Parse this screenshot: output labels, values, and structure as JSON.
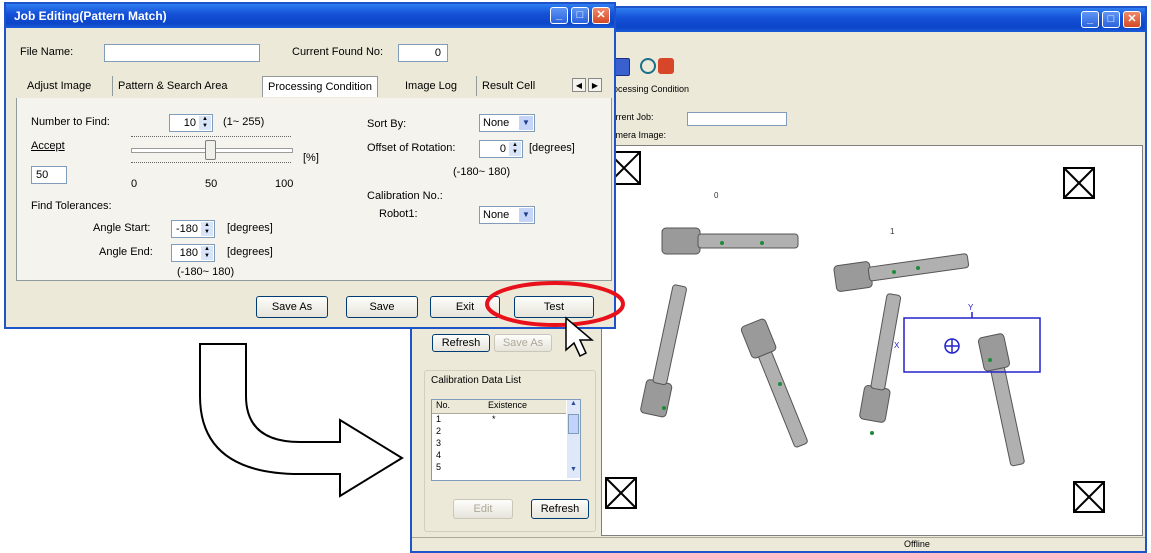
{
  "job_window": {
    "title": "Job Editing(Pattern Match)",
    "file_name_label": "File Name:",
    "file_name_value": "",
    "current_found_label": "Current Found No:",
    "current_found_value": "0",
    "tabs": [
      "Adjust Image",
      "Pattern & Search Area",
      "Processing Condition",
      "Image Log",
      "Result Cell"
    ],
    "active_tab": "Processing Condition",
    "number_to_find_label": "Number to Find:",
    "number_to_find_value": "10",
    "number_to_find_range": "(1~ 255)",
    "accept_label": "Accept",
    "accept_value": "50",
    "accept_unit": "[%]",
    "slider_ticks": [
      "0",
      "50",
      "100"
    ],
    "slider_level": 0.5,
    "sort_by_label": "Sort By:",
    "sort_by_value": "None",
    "offset_rotation_label": "Offset of Rotation:",
    "offset_rotation_value": "0",
    "offset_rotation_unit": "[degrees]",
    "offset_rotation_range": "(-180~ 180)",
    "calibration_no_label": "Calibration No.:",
    "robot1_label": "Robot1:",
    "robot1_value": "None",
    "find_tolerances_label": "Find Tolerances:",
    "angle_start_label": "Angle Start:",
    "angle_start_value": "-180",
    "angle_end_label": "Angle End:",
    "angle_end_value": "180",
    "degrees_unit": "[degrees]",
    "angle_range": "(-180~ 180)",
    "buttons": {
      "save_as": "Save As",
      "save": "Save",
      "exit": "Exit",
      "test": "Test"
    }
  },
  "main_window": {
    "title": "",
    "processing_condition_label": "Processing Condition",
    "current_job_label": "Current Job:",
    "camera_image_label": "Camera Image:",
    "refresh_label": "Refresh",
    "save_as_label": "Save As",
    "calibration_list_title": "Calibration Data List",
    "calibration_columns": [
      "No.",
      "Existence"
    ],
    "calibration_rows": [
      {
        "no": "1",
        "existence": "*"
      },
      {
        "no": "2",
        "existence": ""
      },
      {
        "no": "3",
        "existence": ""
      },
      {
        "no": "4",
        "existence": ""
      },
      {
        "no": "5",
        "existence": ""
      }
    ],
    "edit_label": "Edit",
    "refresh2_label": "Refresh",
    "status_text": "Offline",
    "image_labels": [
      "0",
      "1",
      "Y",
      "X"
    ]
  },
  "colors": {
    "highlight_ring": "#e8101a",
    "xp_title_blue": "#0b45c8",
    "window_face": "#ece9d8",
    "match_mark": "#1f8a3a",
    "search_box": "#2222cc"
  }
}
